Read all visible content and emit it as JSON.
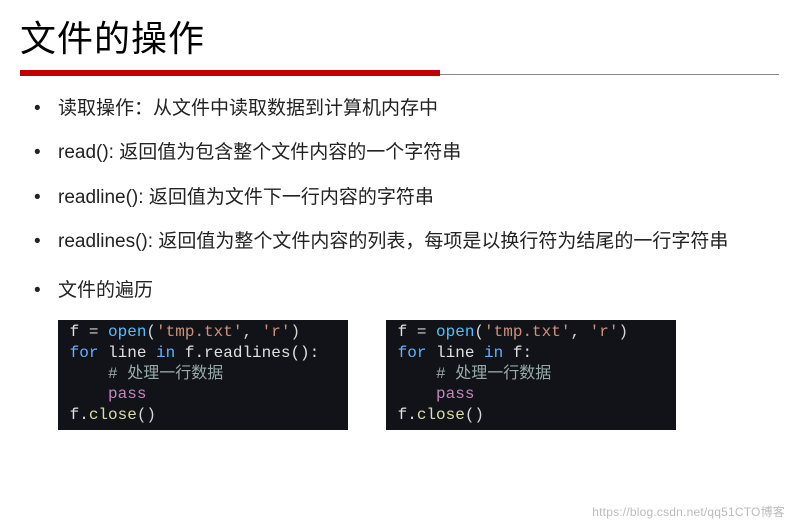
{
  "title": "文件的操作",
  "bullets": [
    "读取操作：从文件中读取数据到计算机内存中",
    "read(): 返回值为包含整个文件内容的一个字符串",
    "readline(): 返回值为文件下一行内容的字符串",
    "readlines(): 返回值为整个文件内容的列表，每项是以换行符为结尾的一行字符串"
  ],
  "bullet_traverse": "文件的遍历",
  "code": {
    "left": {
      "l1_a": "f ",
      "l1_b": "= ",
      "l1_c": "open",
      "l1_d": "(",
      "l1_e": "'tmp.txt'",
      "l1_f": ", ",
      "l1_g": "'r'",
      "l1_h": ")",
      "l2_a": "for",
      "l2_b": " line ",
      "l2_c": "in",
      "l2_d": " f.readlines():",
      "l3": "# 处理一行数据",
      "l4": "pass",
      "l5_a": "f.",
      "l5_b": "close",
      "l5_c": "()"
    },
    "right": {
      "l1_a": "f ",
      "l1_b": "= ",
      "l1_c": "open",
      "l1_d": "(",
      "l1_e": "'tmp.txt'",
      "l1_f": ", ",
      "l1_g": "'r'",
      "l1_h": ")",
      "l2_a": "for",
      "l2_b": " line ",
      "l2_c": "in",
      "l2_d": " f:",
      "l3": "# 处理一行数据",
      "l4": "pass",
      "l5_a": "f.",
      "l5_b": "close",
      "l5_c": "()"
    }
  },
  "watermark": "https://blog.csdn.net/qq51CTO博客"
}
